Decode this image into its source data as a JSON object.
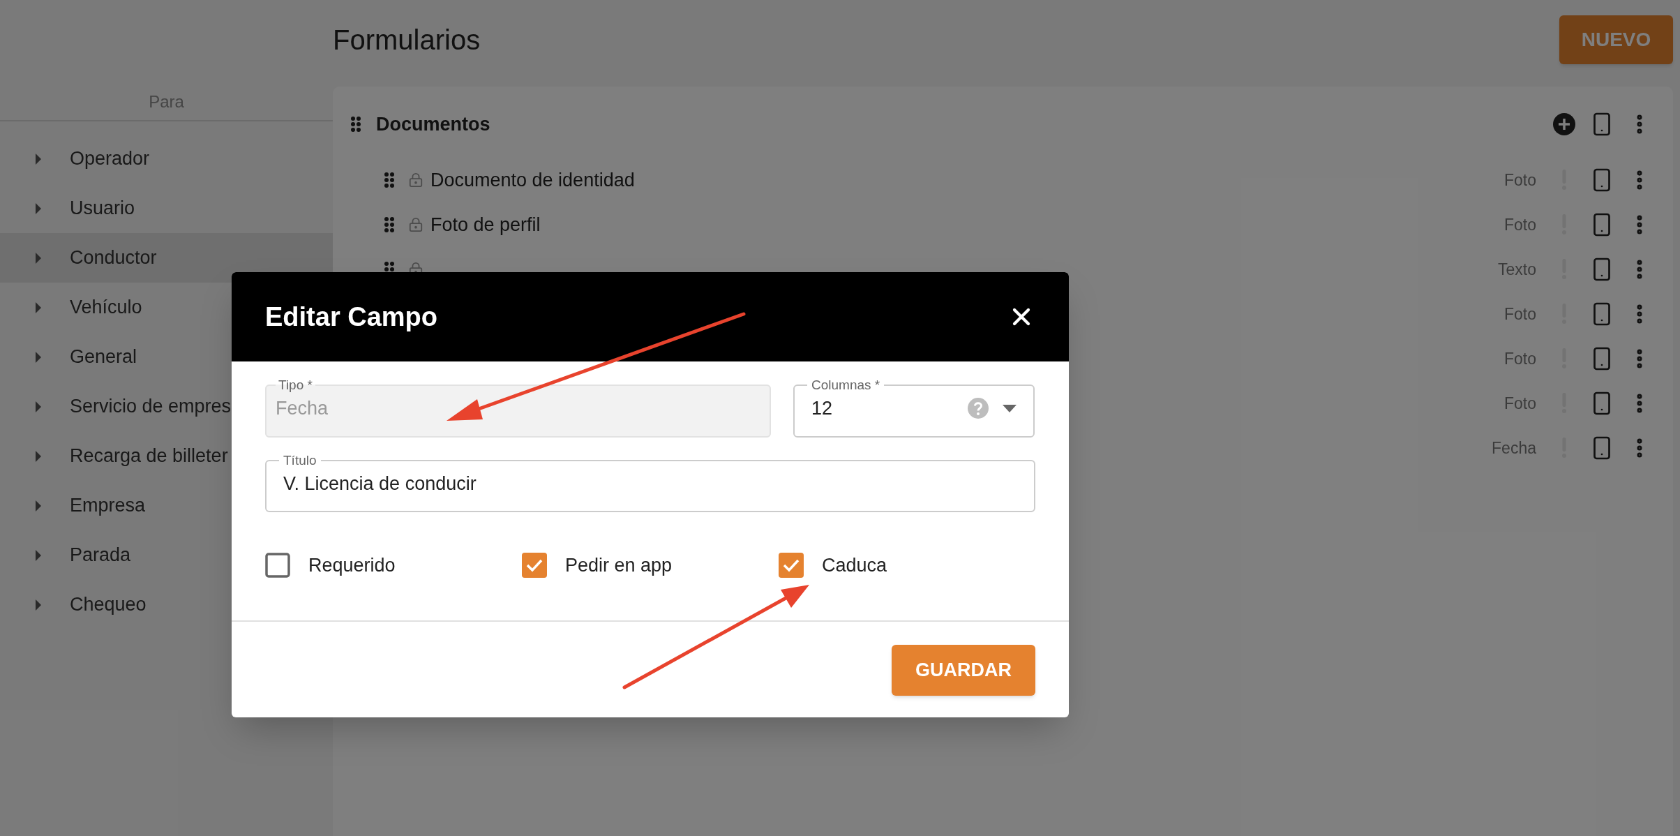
{
  "page_title": "Formularios",
  "new_button": "NUEVO",
  "sidebar": {
    "header": "Para",
    "items": [
      {
        "label": "Operador",
        "selected": false
      },
      {
        "label": "Usuario",
        "selected": false
      },
      {
        "label": "Conductor",
        "selected": true
      },
      {
        "label": "Vehículo",
        "selected": false
      },
      {
        "label": "General",
        "selected": false
      },
      {
        "label": "Servicio de empres",
        "selected": false
      },
      {
        "label": "Recarga de billeter",
        "selected": false
      },
      {
        "label": "Empresa",
        "selected": false
      },
      {
        "label": "Parada",
        "selected": false
      },
      {
        "label": "Chequeo",
        "selected": false
      }
    ]
  },
  "section": {
    "title": "Documentos",
    "fields": [
      {
        "name": "Documento de identidad",
        "locked": true,
        "type": "Foto"
      },
      {
        "name": "Foto de perfil",
        "locked": true,
        "type": "Foto"
      },
      {
        "locked": true,
        "type": "Texto"
      },
      {
        "type": "Foto"
      },
      {
        "type": "Foto"
      },
      {
        "type": "Foto"
      },
      {
        "type": "Fecha"
      }
    ]
  },
  "dialog": {
    "title": "Editar Campo",
    "tipo": {
      "label": "Tipo *",
      "value": "Fecha",
      "disabled": true
    },
    "columnas": {
      "label": "Columnas *",
      "value": "12"
    },
    "titulo": {
      "label": "Título",
      "value": "V. Licencia de conducir"
    },
    "checkboxes": [
      {
        "label": "Requerido",
        "checked": false
      },
      {
        "label": "Pedir en app",
        "checked": true
      },
      {
        "label": "Caduca",
        "checked": true
      }
    ],
    "save_button": "GUARDAR"
  }
}
